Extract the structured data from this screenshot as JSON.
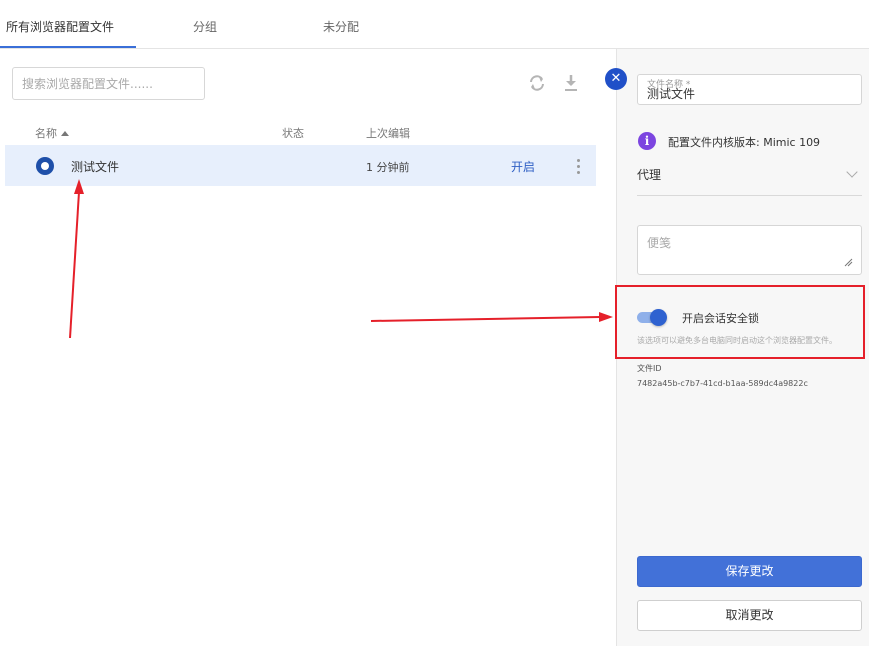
{
  "tabs": [
    {
      "label": "所有浏览器配置文件"
    },
    {
      "label": "分组"
    },
    {
      "label": "未分配"
    }
  ],
  "search": {
    "placeholder": "搜索浏览器配置文件......"
  },
  "table": {
    "headers": {
      "name": "名称",
      "status": "状态",
      "last_edited": "上次编辑"
    },
    "rows": [
      {
        "name": "测试文件",
        "status": "",
        "last_edited": "1 分钟前",
        "action": "开启"
      }
    ]
  },
  "panel": {
    "file_name_label": "文件名称 *",
    "file_name_value": "测试文件",
    "kernel_version": "配置文件内核版本: Mimic 109",
    "proxy_label": "代理",
    "notes_placeholder": "便笺",
    "lock_label": "开启会话安全锁",
    "lock_enabled": true,
    "lock_description": "该选项可以避免多台电脑同时启动这个浏览器配置文件。",
    "file_id_label": "文件ID",
    "file_id_value": "7482a45b-c7b7-41cd-b1aa-589dc4a9822c",
    "save_button": "保存更改",
    "cancel_button": "取消更改"
  },
  "colors": {
    "accent": "#4271d8",
    "selected_row": "#e7effc",
    "annotation": "#e5202a",
    "info_icon": "#7c45e0"
  }
}
